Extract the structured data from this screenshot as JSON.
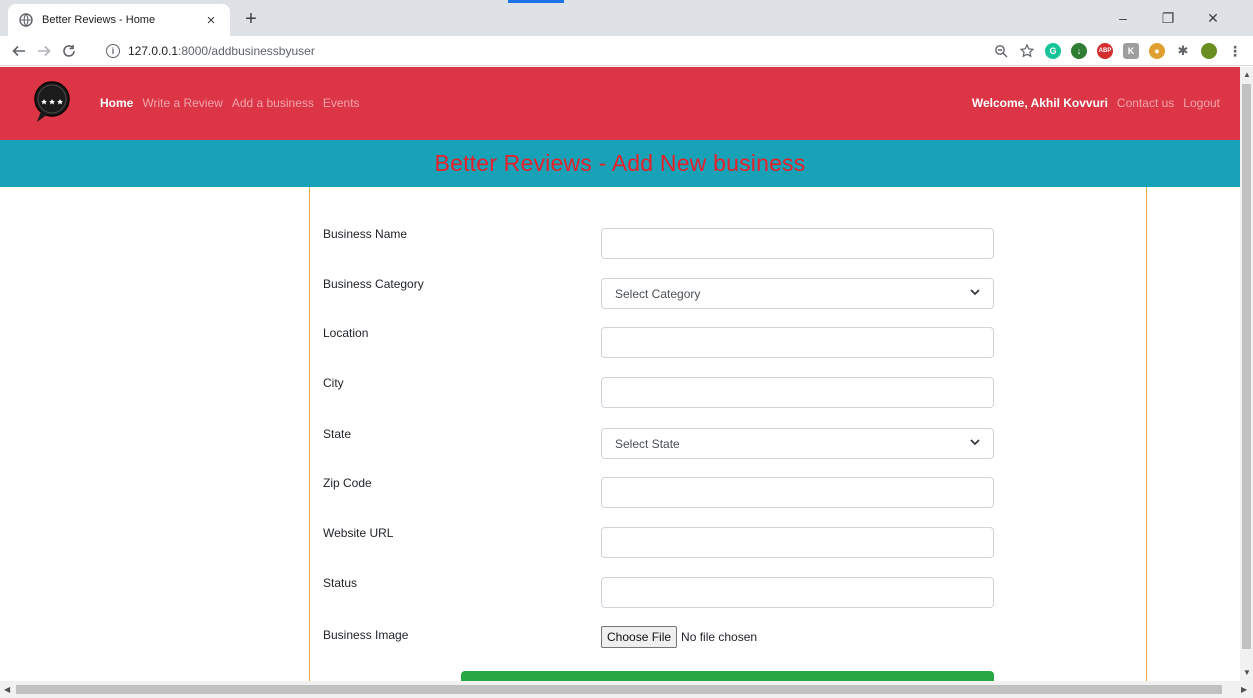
{
  "browser": {
    "tab_title": "Better Reviews - Home",
    "tab_close": "×",
    "new_tab": "+",
    "url_host": "127.0.0.1",
    "url_rest": ":8000/addbusinessbyuser",
    "window": {
      "minimize": "–",
      "restore": "❐",
      "close": "✕"
    },
    "extensions": [
      {
        "name": "grammarly-icon",
        "label": "G",
        "color": "#15c39a"
      },
      {
        "name": "download-ext-icon",
        "label": "↓",
        "color": "#2e7d32"
      },
      {
        "name": "adblock-icon",
        "label": "ABP",
        "color": "#d32f2f"
      },
      {
        "name": "extension-k-icon",
        "label": "K",
        "color": "#9e9e9e"
      },
      {
        "name": "cookie-icon",
        "label": "●",
        "color": "#e0a030"
      },
      {
        "name": "puzzle-icon",
        "label": "✱",
        "color": "#5f6368"
      },
      {
        "name": "profile-avatar-icon",
        "label": "",
        "color": "#6b8e23"
      }
    ]
  },
  "navbar": {
    "links": [
      "Home",
      "Write a Review",
      "Add a business",
      "Events"
    ],
    "welcome": "Welcome, Akhil Kovvuri",
    "contact": "Contact us",
    "logout": "Logout"
  },
  "banner": {
    "title": "Better Reviews - Add New business"
  },
  "form": {
    "business_name": {
      "label": "Business Name",
      "value": ""
    },
    "category": {
      "label": "Business Category",
      "selected": "Select Category"
    },
    "location": {
      "label": "Location",
      "value": ""
    },
    "city": {
      "label": "City",
      "value": ""
    },
    "state": {
      "label": "State",
      "selected": "Select State"
    },
    "zip": {
      "label": "Zip Code",
      "value": ""
    },
    "website": {
      "label": "Website URL",
      "value": ""
    },
    "status": {
      "label": "Status",
      "value": ""
    },
    "image": {
      "label": "Business Image",
      "button": "Choose File",
      "file_text": "No file chosen"
    }
  }
}
